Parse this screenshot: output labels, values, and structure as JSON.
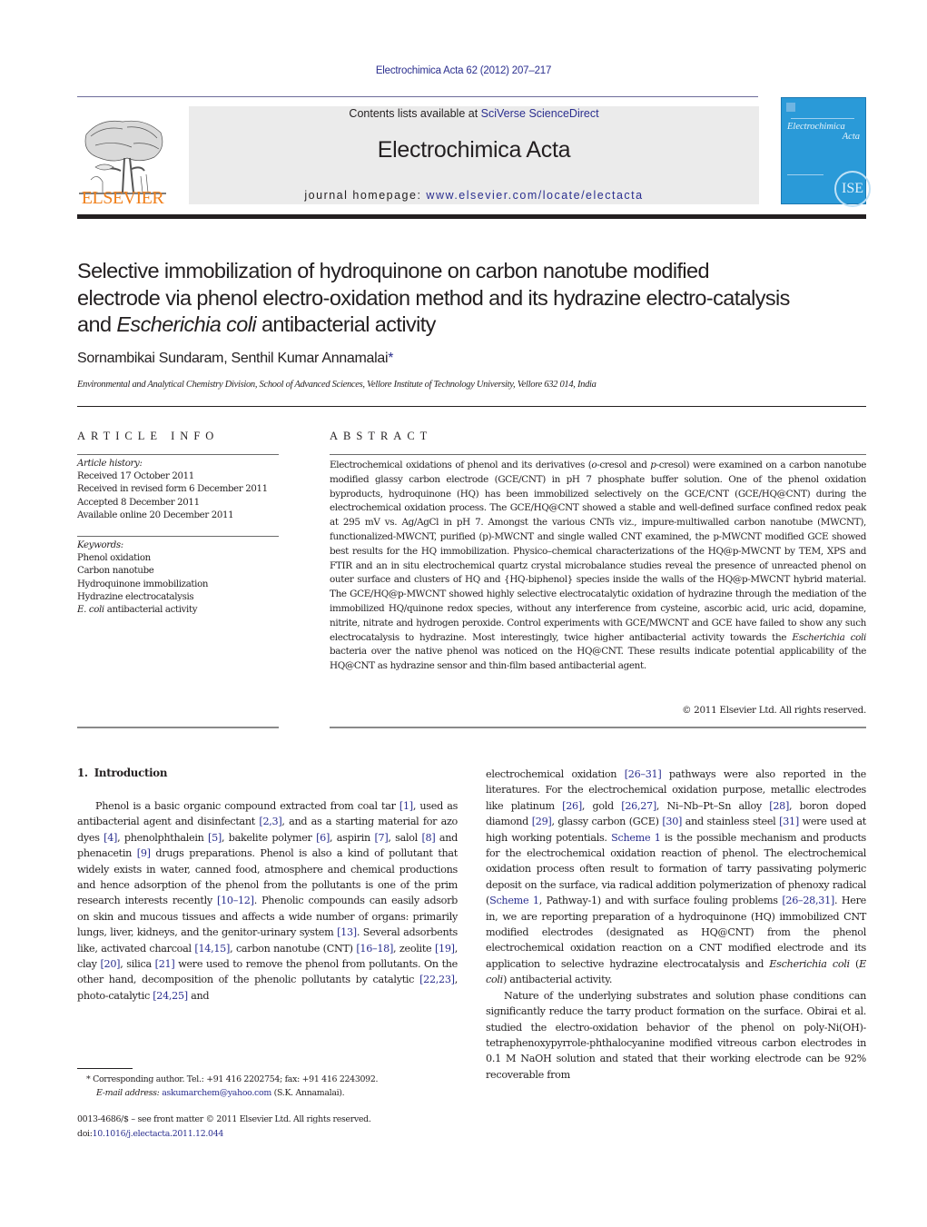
{
  "header": {
    "journal_ref": "Electrochimica Acta 62 (2012) 207–217",
    "contents_prefix": "Contents lists available at ",
    "contents_link": "SciVerse ScienceDirect",
    "journal_name": "Electrochimica Acta",
    "homepage_prefix": "journal homepage: ",
    "homepage_link": "www.elsevier.com/locate/electacta",
    "publisher_logo_text": "ELSEVIER",
    "cover": {
      "title_line1": "Electrochimica",
      "title_line2": "Acta",
      "seal_text": "ISE",
      "bg_color": "#2a9ad8"
    },
    "colors": {
      "link": "#2b2f8f",
      "publisher_orange": "#f07f1a",
      "banner_bg": "#ebebeb"
    }
  },
  "article": {
    "title_line1": "Selective immobilization of hydroquinone on carbon nanotube modified",
    "title_line2": "electrode via phenol electro-oxidation method and its hydrazine electro-catalysis",
    "title_line3_pre": "and ",
    "title_line3_italic": "Escherichia coli",
    "title_line3_post": " antibacterial activity",
    "authors": "Sornambikai Sundaram, Senthil Kumar Annamalai",
    "author_mark": "*",
    "affiliation": "Environmental and Analytical Chemistry Division, School of Advanced Sciences, Vellore Institute of Technology University, Vellore 632 014, India"
  },
  "article_info": {
    "heading": "ARTICLE INFO",
    "history_label": "Article history:",
    "history": [
      "Received 17 October 2011",
      "Received in revised form 6 December 2011",
      "Accepted 8 December 2011",
      "Available online 20 December 2011"
    ],
    "keywords_label": "Keywords:",
    "keywords": [
      "Phenol oxidation",
      "Carbon nanotube",
      "Hydroquinone immobilization",
      "Hydrazine electrocatalysis"
    ],
    "keyword_last_italic": "E. coli",
    "keyword_last_rest": " antibacterial activity"
  },
  "abstract": {
    "heading": "ABSTRACT",
    "p1": "Electrochemical oxidations of phenol and its derivatives (",
    "o": "o",
    "p2": "-cresol and ",
    "p": "p",
    "p3": "-cresol) were examined on a carbon nanotube modified glassy carbon electrode (GCE/CNT) in pH 7 phosphate buffer solution. One of the phenol oxidation byproducts, hydroquinone (HQ) has been immobilized selectively on the GCE/CNT (GCE/HQ@CNT) during the electrochemical oxidation process. The GCE/HQ@CNT showed a stable and well-defined surface confined redox peak at 295 mV vs. Ag/AgCl in pH 7. Amongst the various CNTs viz., impure-multiwalled carbon nanotube (MWCNT), functionalized-MWCNT, purified (p)-MWCNT and single walled CNT examined, the p-MWCNT modified GCE showed best results for the HQ immobilization. Physico–chemical characterizations of the HQ@p-MWCNT by TEM, XPS and FTIR and an in situ electrochemical quartz crystal microbalance studies reveal the presence of unreacted phenol on outer surface and clusters of HQ and {HQ-biphenol} species inside the walls of the HQ@p-MWCNT hybrid material. The GCE/HQ@p-MWCNT showed highly selective electrocatalytic oxidation of hydrazine through the mediation of the immobilized HQ/quinone redox species, without any interference from cysteine, ascorbic acid, uric acid, dopamine, nitrite, nitrate and hydrogen peroxide. Control experiments with GCE/MWCNT and GCE have failed to show any such electrocatalysis to hydrazine. Most interestingly, twice higher antibacterial activity towards the ",
    "ecoli": "Escherichia coli",
    "p4": " bacteria over the native phenol was noticed on the HQ@CNT. These results indicate potential applicability of the HQ@CNT as hydrazine sensor and thin-film based antibacterial agent.",
    "copyright": "© 2011 Elsevier Ltd. All rights reserved."
  },
  "introduction": {
    "number": "1.",
    "heading": "Introduction",
    "left": [
      {
        "t": "Phenol is a basic organic compound extracted from coal tar "
      },
      {
        "r": "[1]"
      },
      {
        "t": ", used as antibacterial agent and disinfectant "
      },
      {
        "r": "[2,3]"
      },
      {
        "t": ", and as a starting material for azo dyes "
      },
      {
        "r": "[4]"
      },
      {
        "t": ", phenolphthalein "
      },
      {
        "r": "[5]"
      },
      {
        "t": ", bakelite polymer "
      },
      {
        "r": "[6]"
      },
      {
        "t": ", aspirin "
      },
      {
        "r": "[7]"
      },
      {
        "t": ", salol "
      },
      {
        "r": "[8]"
      },
      {
        "t": " and phenacetin "
      },
      {
        "r": "[9]"
      },
      {
        "t": " drugs preparations. Phenol is also a kind of pollutant that widely exists in water, canned food, atmosphere and chemical productions and hence adsorption of the phenol from the pollutants is one of the prim research interests recently "
      },
      {
        "r": "[10–12]"
      },
      {
        "t": ". Phenolic compounds can easily adsorb on skin and mucous tissues and affects a wide number of organs: primarily lungs, liver, kidneys, and the genitor-urinary system "
      },
      {
        "r": "[13]"
      },
      {
        "t": ". Several adsorbents like, activated charcoal "
      },
      {
        "r": "[14,15]"
      },
      {
        "t": ", carbon nanotube (CNT) "
      },
      {
        "r": "[16–18]"
      },
      {
        "t": ", zeolite "
      },
      {
        "r": "[19]"
      },
      {
        "t": ", clay "
      },
      {
        "r": "[20]"
      },
      {
        "t": ", silica "
      },
      {
        "r": "[21]"
      },
      {
        "t": " were used to remove the phenol from pollutants. On the other hand, decomposition of the phenolic pollutants by catalytic "
      },
      {
        "r": "[22,23]"
      },
      {
        "t": ", photo-catalytic "
      },
      {
        "r": "[24,25]"
      },
      {
        "t": " and"
      }
    ],
    "right_p1": [
      {
        "t": "electrochemical oxidation "
      },
      {
        "r": "[26–31]"
      },
      {
        "t": " pathways were also reported in the literatures. For the electrochemical oxidation purpose, metallic electrodes like platinum "
      },
      {
        "r": "[26]"
      },
      {
        "t": ", gold "
      },
      {
        "r": "[26,27]"
      },
      {
        "t": ", Ni–Nb–Pt–Sn alloy "
      },
      {
        "r": "[28]"
      },
      {
        "t": ", boron doped diamond "
      },
      {
        "r": "[29]"
      },
      {
        "t": ", glassy carbon (GCE) "
      },
      {
        "r": "[30]"
      },
      {
        "t": " and stainless steel "
      },
      {
        "r": "[31]"
      },
      {
        "t": " were used at high working potentials. "
      },
      {
        "r": "Scheme 1"
      },
      {
        "t": " is the possible mechanism and products for the electrochemical oxidation reaction of phenol. The electrochemical oxidation process often result to formation of tarry passivating polymeric deposit on the surface, via radical addition polymerization of phenoxy radical ("
      },
      {
        "r": "Scheme 1"
      },
      {
        "t": ", Pathway-1) and with surface fouling problems "
      },
      {
        "r": "[26–28,31]"
      },
      {
        "t": ". Here in, we are reporting preparation of a hydroquinone (HQ) immobilized CNT modified electrodes (designated as HQ@CNT) from the phenol electrochemical oxidation reaction on a CNT modified electrode and its application to selective hydrazine electrocatalysis and "
      },
      {
        "i": "Escherichia coli"
      },
      {
        "t": " ("
      },
      {
        "i": "E coli"
      },
      {
        "t": ") antibacterial activity."
      }
    ],
    "right_p2": "Nature of the underlying substrates and solution phase conditions can significantly reduce the tarry product formation on the surface. Obirai et al. studied the electro-oxidation behavior of the phenol on poly-Ni(OH)-tetraphenoxypyrrole-phthalocyanine modified vitreous carbon electrodes in 0.1 M NaOH solution and stated that their working electrode can be 92% recoverable from"
  },
  "footnote": {
    "mark": "*",
    "corresponding": "Corresponding author. Tel.: +91 416 2202754; fax: +91 416 2243092.",
    "email_label": "E-mail address: ",
    "email": "askumarchem@yahoo.com",
    "email_suffix": " (S.K. Annamalai).",
    "issn": "0013-4686/$ – see front matter © 2011 Elsevier Ltd. All rights reserved.",
    "doi_prefix": "doi:",
    "doi": "10.1016/j.electacta.2011.12.044"
  }
}
